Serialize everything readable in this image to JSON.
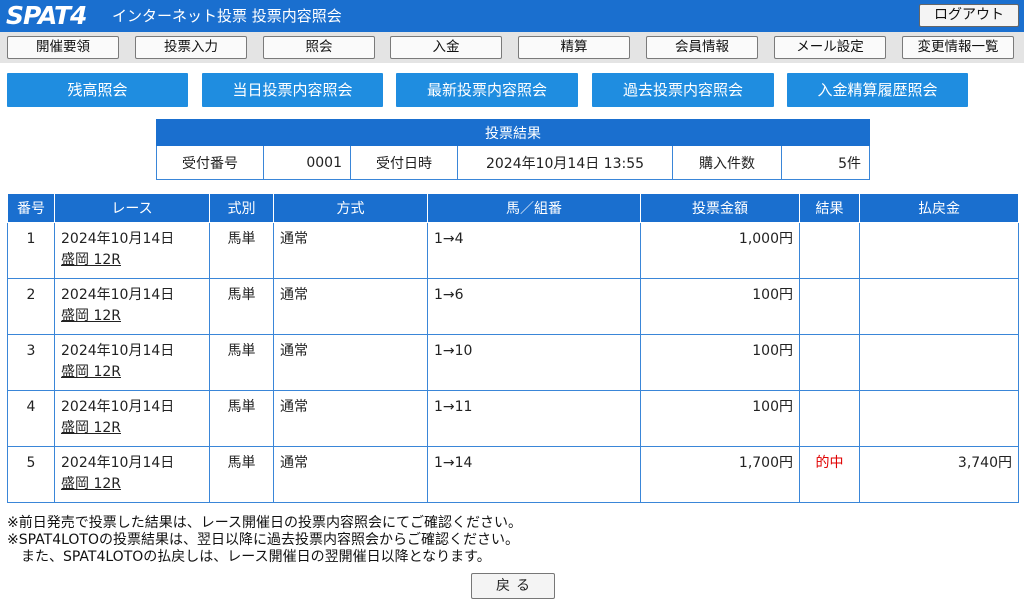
{
  "header": {
    "logo": "SPAT4",
    "title": "インターネット投票 投票内容照会",
    "logout": "ログアウト"
  },
  "nav": [
    "開催要領",
    "投票入力",
    "照会",
    "入金",
    "精算",
    "会員情報",
    "メール設定",
    "変更情報一覧"
  ],
  "sub_buttons": [
    "残高照会",
    "当日投票内容照会",
    "最新投票内容照会",
    "過去投票内容照会",
    "入金精算履歴照会"
  ],
  "summary": {
    "title": "投票結果",
    "receipt_no_label": "受付番号",
    "receipt_no": "0001",
    "receipt_time_label": "受付日時",
    "receipt_time": "2024年10月14日 13:55",
    "count_label": "購入件数",
    "count": "5件"
  },
  "results": {
    "headers": [
      "番号",
      "レース",
      "式別",
      "方式",
      "馬／組番",
      "投票金額",
      "結果",
      "払戻金"
    ],
    "rows": [
      {
        "no": "1",
        "date": "2024年10月14日",
        "race": "盛岡 12R",
        "type": "馬単",
        "method": "通常",
        "combo": "1→4",
        "amount": "1,000円",
        "result": "",
        "payout": ""
      },
      {
        "no": "2",
        "date": "2024年10月14日",
        "race": "盛岡 12R",
        "type": "馬単",
        "method": "通常",
        "combo": "1→6",
        "amount": "100円",
        "result": "",
        "payout": ""
      },
      {
        "no": "3",
        "date": "2024年10月14日",
        "race": "盛岡 12R",
        "type": "馬単",
        "method": "通常",
        "combo": "1→10",
        "amount": "100円",
        "result": "",
        "payout": ""
      },
      {
        "no": "4",
        "date": "2024年10月14日",
        "race": "盛岡 12R",
        "type": "馬単",
        "method": "通常",
        "combo": "1→11",
        "amount": "100円",
        "result": "",
        "payout": ""
      },
      {
        "no": "5",
        "date": "2024年10月14日",
        "race": "盛岡 12R",
        "type": "馬単",
        "method": "通常",
        "combo": "1→14",
        "amount": "1,700円",
        "result": "的中",
        "payout": "3,740円"
      }
    ]
  },
  "notes": [
    "※前日発売で投票した結果は、レース開催日の投票内容照会にてご確認ください。",
    "※SPAT4LOTOの投票結果は、翌日以降に過去投票内容照会からご確認ください。",
    "　また、SPAT4LOTOの払戻しは、レース開催日の翌開催日以降となります。"
  ],
  "back_button": "戻る"
}
